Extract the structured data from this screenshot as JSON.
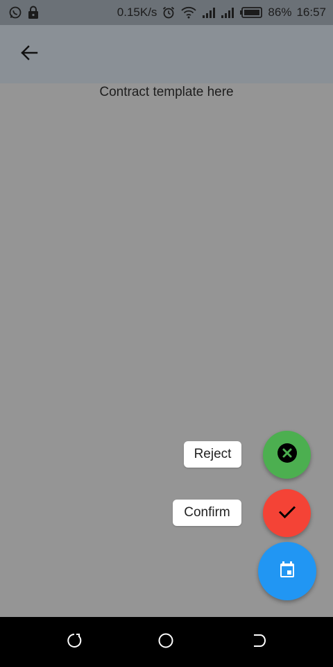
{
  "status_bar": {
    "net_speed": "0.15K/s",
    "battery": "86%",
    "time": "16:57",
    "icons": [
      "whatsapp-icon",
      "lock-icon",
      "alarm-icon",
      "wifi-icon",
      "signal-icon",
      "signal-icon",
      "battery-icon"
    ]
  },
  "app_bar": {
    "back_icon": "arrow-left-icon",
    "color": "#8a9096"
  },
  "content": {
    "text": "Contract template here"
  },
  "speed_dial": {
    "actions": [
      {
        "label": "Reject",
        "icon": "close-circle-icon",
        "color": "#4caf50"
      },
      {
        "label": "Confirm",
        "icon": "check-icon",
        "color": "#f44336"
      }
    ],
    "main_button": {
      "icon": "calendar-icon",
      "color": "#2196f3"
    }
  },
  "nav_bar": {
    "buttons": [
      "recent-apps-icon",
      "home-icon",
      "back-icon"
    ]
  }
}
